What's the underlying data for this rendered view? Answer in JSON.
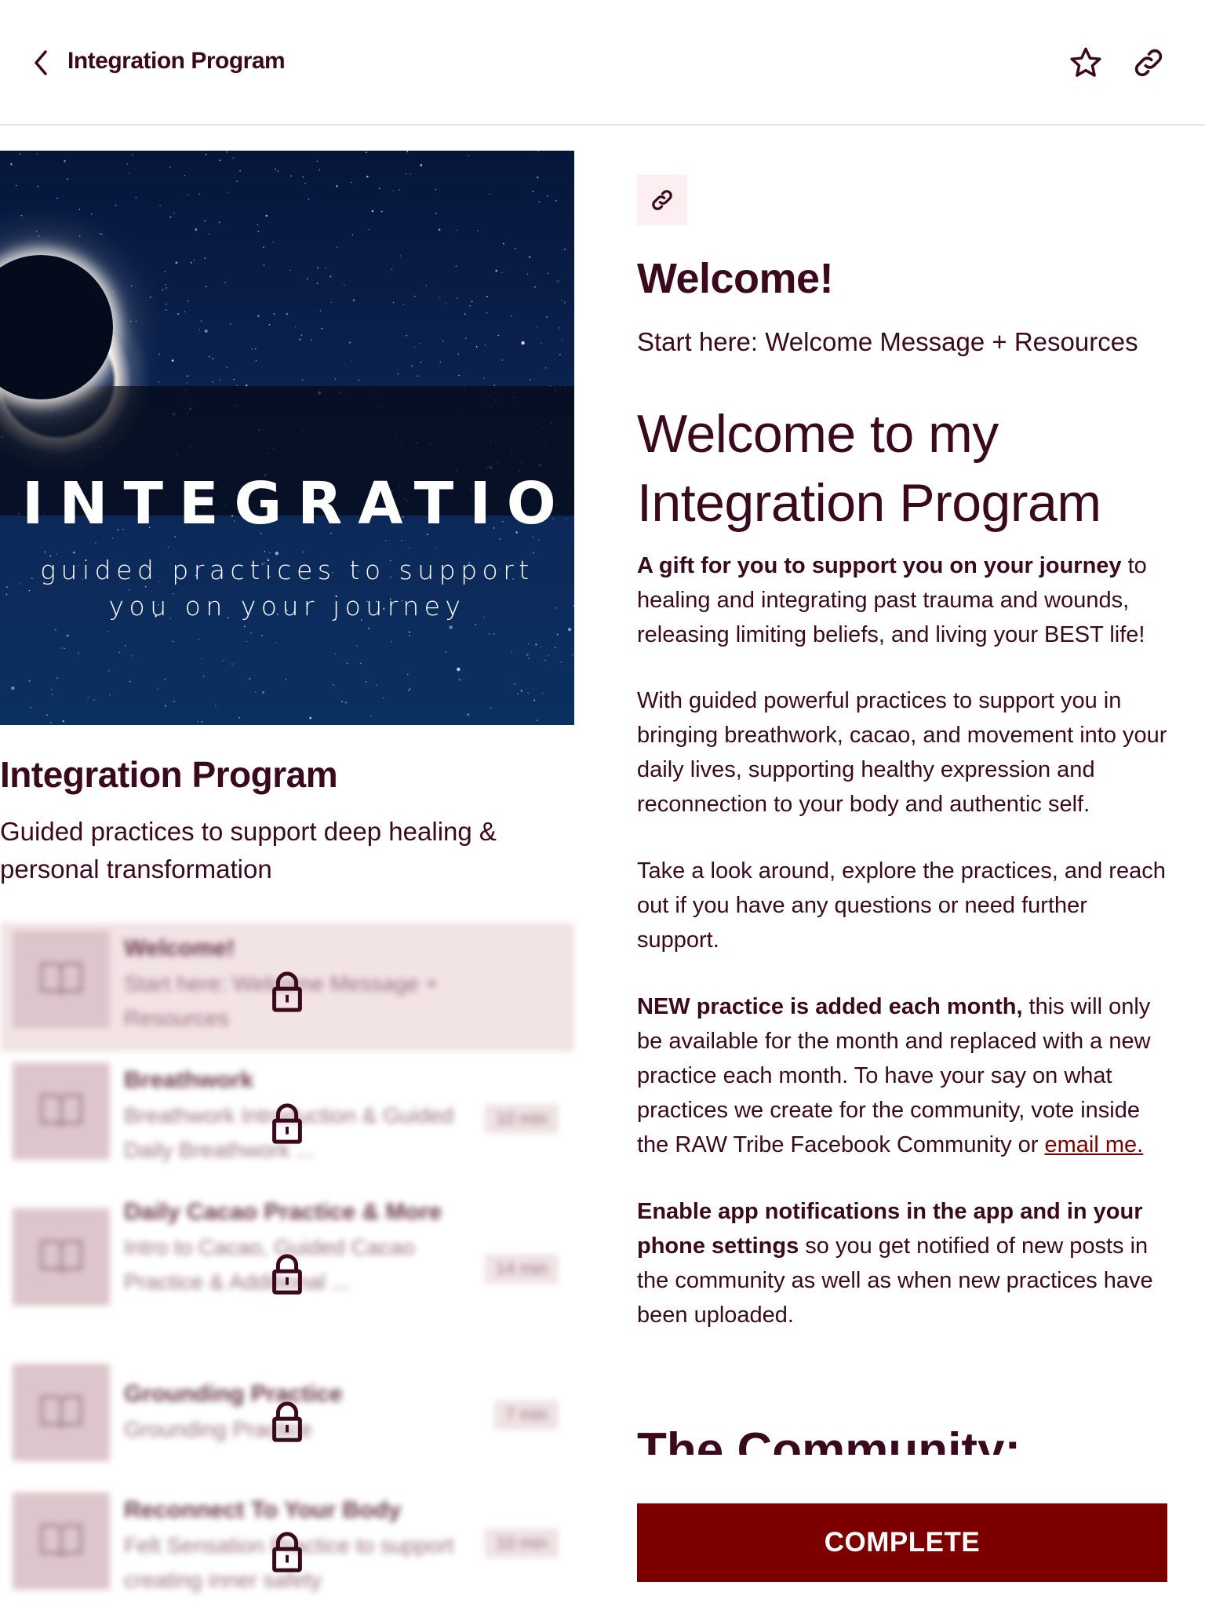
{
  "header": {
    "title": "Integration Program",
    "back_icon": "chevron-left-icon",
    "favorite_icon": "star-icon",
    "share_icon": "link-icon"
  },
  "hero": {
    "title": "INTEGRATION",
    "subtitle_line1": "guided practices to support",
    "subtitle_line2": "you on your journey"
  },
  "program": {
    "title": "Integration Program",
    "description": "Guided practices to support deep healing & personal transformation"
  },
  "lessons": [
    {
      "title": "Welcome!",
      "description": "Start here: Welcome Message + Resources",
      "duration": "",
      "locked": true,
      "active": true,
      "icon": "book-icon"
    },
    {
      "title": "Breathwork",
      "description": "Breathwork Introduction & Guided Daily Breathwork ...",
      "duration": "10 min",
      "locked": true,
      "active": false,
      "icon": "book-icon"
    },
    {
      "title": "Daily Cacao Practice & More",
      "description": "Intro to Cacao, Guided Cacao Practice & Additional ...",
      "duration": "14 min",
      "locked": true,
      "active": false,
      "icon": "book-icon"
    },
    {
      "title": "Grounding Practice",
      "description": "Grounding Practice",
      "duration": "7 min",
      "locked": true,
      "active": false,
      "icon": "book-icon"
    },
    {
      "title": "Reconnect To Your Body",
      "description": "Felt Sensation Practice to support creating inner safety",
      "duration": "10 min",
      "locked": true,
      "active": false,
      "icon": "book-icon"
    }
  ],
  "lesson_detail": {
    "type_icon": "link-icon",
    "title": "Welcome!",
    "subtitle": "Start here: Welcome Message + Resources",
    "heading": "Welcome to my Integration Program",
    "p1_bold": "A gift for you to support you on your journey",
    "p1_rest": " to healing and integrating past trauma and wounds, releasing limiting beliefs, and living your BEST life!",
    "p2": "With guided powerful practices to support you in bringing breathwork, cacao, and movement into your daily lives, supporting healthy expression and reconnection to your body and authentic self.",
    "p3": "Take a look around, explore the practices, and reach out if you have any questions or need further support.",
    "p4_bold": "NEW practice is added each month,",
    "p4_rest": " this will only be available for the month and replaced with a new practice each month. To have your say on what practices we create for the community, vote inside the RAW Tribe Facebook Community or ",
    "p4_link": "email me.",
    "p5_bold": "Enable app notifications in the app and in your phone settings",
    "p5_rest": " so you get notified of new posts in the community as well as when new practices have been uploaded.",
    "community_heading": "The Community:"
  },
  "complete_button": "COMPLETE",
  "colors": {
    "text": "#3a0a1c",
    "accent": "#7d0000",
    "chip_bg": "#fdeef1",
    "active_row_bg": "#f2e3e5",
    "divider": "#e5e5e5"
  }
}
